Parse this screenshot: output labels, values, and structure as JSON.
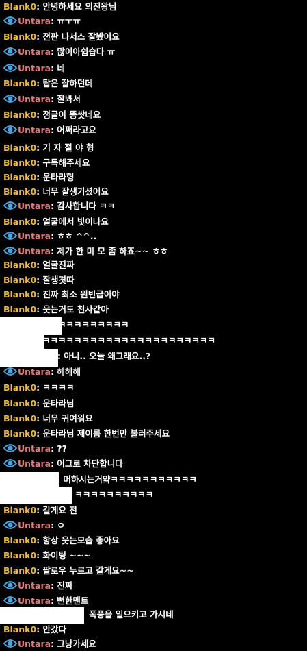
{
  "colors": {
    "background": "#000000",
    "blank0": "#e6b84a",
    "untara": "#e07a7a",
    "eye": "#4aa3df",
    "text": "#ffffff"
  },
  "icons": {
    "eye": "eye-icon"
  },
  "messages": [
    {
      "user": "Blank0",
      "text": "안녕하세요 의진왕님"
    },
    {
      "user": "Untara",
      "text": "ㅠㅜㅠ"
    },
    {
      "user": "Blank0",
      "text": "전판 나서스 잘봤어요"
    },
    {
      "user": "Untara",
      "text": "많이아쉽습다 ㅠ"
    },
    {
      "user": "Untara",
      "text": "네"
    },
    {
      "user": "Blank0",
      "text": "탑은 잘하던데"
    },
    {
      "user": "Untara",
      "text": "잘봐서"
    },
    {
      "user": "Blank0",
      "text": "정글이 똥쌋네요"
    },
    {
      "user": "Untara",
      "text": "어쩌라고요"
    },
    {
      "user": "Blank0",
      "text": "기 자 절 야 형"
    },
    {
      "user": "Blank0",
      "text": "구독해주세요"
    },
    {
      "user": "Blank0",
      "text": "운타라형"
    },
    {
      "user": "Blank0",
      "text": "너무 잘생기셨어요"
    },
    {
      "user": "Untara",
      "text": "감사합니다 ㅋㅋ"
    },
    {
      "user": "Blank0",
      "text": "얼굴에서 빛이나요"
    },
    {
      "user": "Untara",
      "text": "ㅎㅎ ^^.."
    },
    {
      "user": "Untara",
      "text": "제가 한 미 모 좀 하죠~~ ㅎㅎ"
    },
    {
      "user": "Blank0",
      "text": "얼굴진짜"
    },
    {
      "user": "Blank0",
      "text": "잘생겻따"
    },
    {
      "user": "Blank0",
      "text": "진짜 최소 원빈급이야"
    },
    {
      "user": "Blank0",
      "text": "웃는거도 천사같아"
    },
    {
      "user": "",
      "text": "ㅋㅋㅋㅋㅋㅋㅋㅋㅋㅋㅋ"
    },
    {
      "user": "",
      "text": "ㅋㅋㅋㅋㅋㅋㅋㅋㅋㅋㅋㅋㅋㅋㅋㅋㅋㅋㅋㅋㅋㅋ"
    },
    {
      "user": "",
      "text": ": 아니.. 오늘 왜그래요..?"
    },
    {
      "user": "Untara",
      "text": "헤헤헤"
    },
    {
      "user": "Blank0",
      "text": "ㅋㅋㅋㅋ"
    },
    {
      "user": "Blank0",
      "text": "운타라님"
    },
    {
      "user": "Blank0",
      "text": "너무 귀여워요"
    },
    {
      "user": "Blank0",
      "text": "운타라님 제이름 한번만 불러주세요"
    },
    {
      "user": "Untara",
      "text": "??"
    },
    {
      "user": "Untara",
      "text": "어그로 차단합니다"
    },
    {
      "user": "",
      "text": ": 머하시는거얔ㅋㅋㅋㅋㅋㅋㅋㅋㅋㅋㅋ"
    },
    {
      "user": "",
      "text": ": ㅋㅋㅋㅋㅋㅋㅋㅋㅋㅋ"
    },
    {
      "user": "Blank0",
      "text": "갈게요 전"
    },
    {
      "user": "Untara",
      "text": "ㅇ"
    },
    {
      "user": "Blank0",
      "text": "항상 웃는모습 좋아요"
    },
    {
      "user": "Blank0",
      "text": "화이팅 ~~~"
    },
    {
      "user": "Blank0",
      "text": "팔로우 누르고 갈게요~~"
    },
    {
      "user": "Untara",
      "text": "진짜"
    },
    {
      "user": "Untara",
      "text": "뻔한멘트"
    },
    {
      "user": "",
      "text": "폭풍을 일으키고 가시네"
    },
    {
      "user": "Blank0",
      "text": "안갔다"
    },
    {
      "user": "Untara",
      "text": "그냥가세요"
    }
  ]
}
